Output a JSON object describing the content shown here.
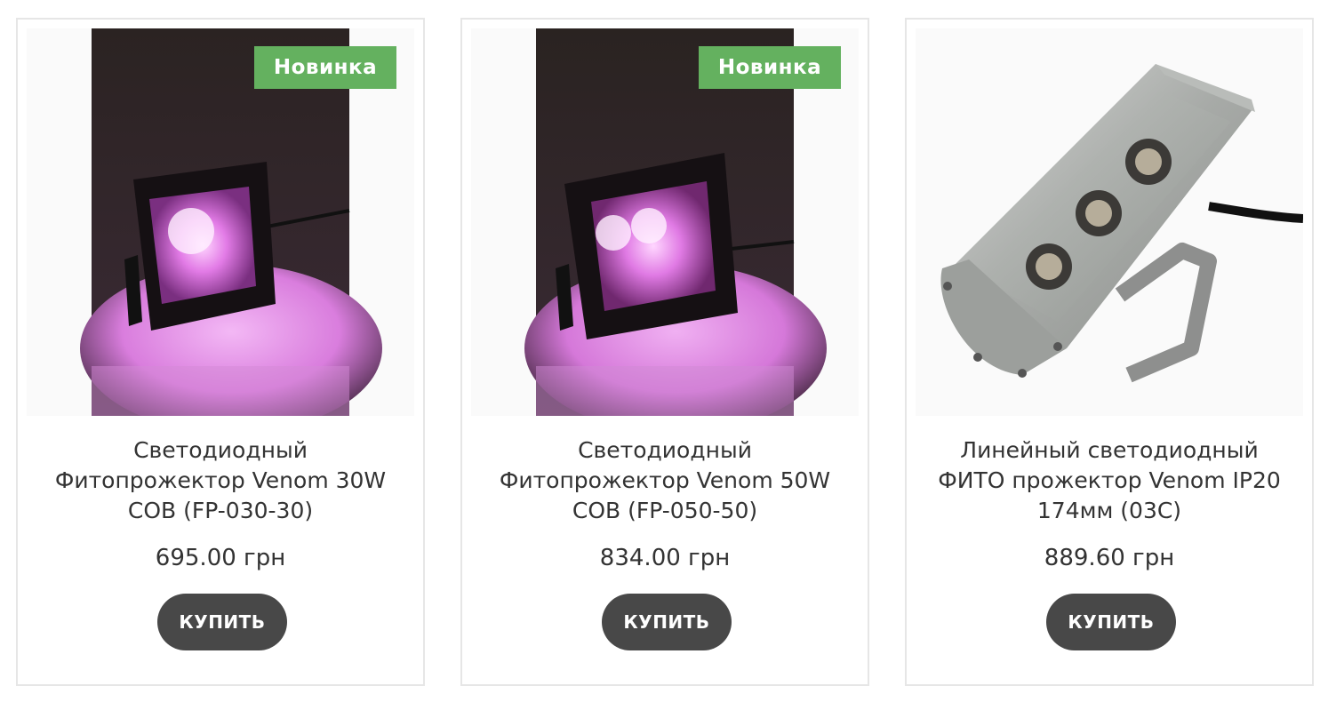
{
  "products": [
    {
      "badge": "Новинка",
      "title": "Светодиодный Фитопрожектор Venom 30W COB (FP-030-30)",
      "price": "695.00 грн",
      "buy_label": "КУПИТЬ"
    },
    {
      "badge": "Новинка",
      "title": "Светодиодный Фитопрожектор Venom 50W COB (FP-050-50)",
      "price": "834.00 грн",
      "buy_label": "КУПИТЬ"
    },
    {
      "badge": "",
      "title": "Линейный светодиодный ФИТО прожектор Venom IP20 174мм (03С)",
      "price": "889.60 грн",
      "buy_label": "КУПИТЬ"
    }
  ],
  "colors": {
    "badge_bg": "#64b15f",
    "button_bg": "#484848",
    "card_border": "#e6e6e6",
    "glow": "#e27be6"
  },
  "images": [
    "purple-led-floodlight-30w-photo",
    "purple-led-floodlight-50w-photo",
    "linear-led-fixture-photo"
  ]
}
